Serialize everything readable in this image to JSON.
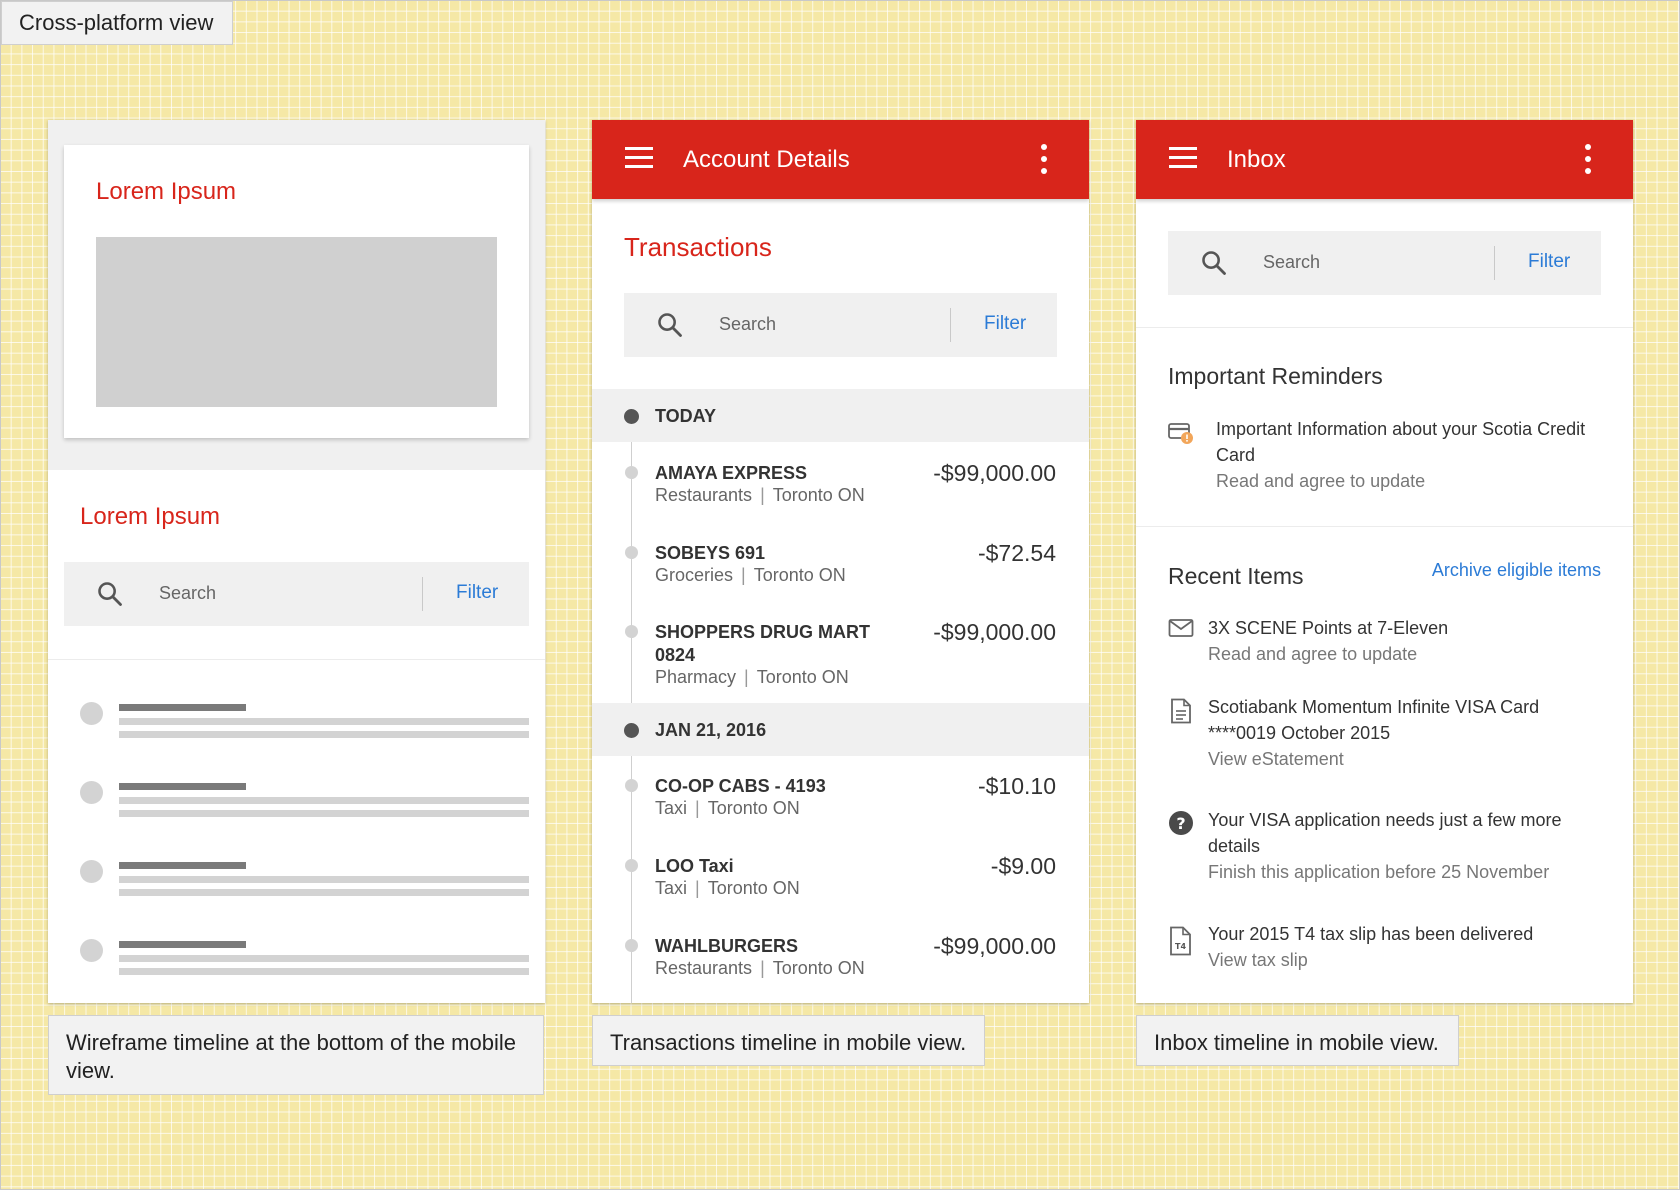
{
  "page": {
    "title": "Cross-platform view"
  },
  "captions": [
    "Wireframe timeline at the bottom of the mobile view.",
    "Transactions timeline in mobile view.",
    "Inbox timeline in mobile view."
  ],
  "wireframe": {
    "card_title": "Lorem Ipsum",
    "section_title": "Lorem Ipsum",
    "search_placeholder": "Search",
    "filter_label": "Filter"
  },
  "account": {
    "appbar_title": "Account Details",
    "section_title": "Transactions",
    "search_placeholder": "Search",
    "filter_label": "Filter",
    "groups": [
      {
        "date": "TODAY",
        "items": [
          {
            "name": "AMAYA EXPRESS",
            "category": "Restaurants",
            "location": "Toronto ON",
            "amount": "-$99,000.00"
          },
          {
            "name": "SOBEYS 691",
            "category": "Groceries",
            "location": "Toronto ON",
            "amount": "-$72.54"
          },
          {
            "name": "SHOPPERS DRUG MART 0824",
            "category": "Pharmacy",
            "location": "Toronto ON",
            "amount": "-$99,000.00"
          }
        ]
      },
      {
        "date": "JAN 21, 2016",
        "items": [
          {
            "name": "CO-OP CABS - 4193",
            "category": "Taxi",
            "location": "Toronto ON",
            "amount": "-$10.10"
          },
          {
            "name": "LOO Taxi",
            "category": "Taxi",
            "location": "Toronto ON",
            "amount": "-$9.00"
          },
          {
            "name": "WAHLBURGERS",
            "category": "Restaurants",
            "location": "Toronto ON",
            "amount": "-$99,000.00"
          }
        ]
      }
    ]
  },
  "inbox": {
    "appbar_title": "Inbox",
    "search_placeholder": "Search",
    "filter_label": "Filter",
    "reminders_title": "Important Reminders",
    "reminder": {
      "icon": "credit-card-alert-icon",
      "title": "Important Information about your Scotia Credit Card",
      "subtitle": "Read and agree to update"
    },
    "recent_title": "Recent Items",
    "archive_link": "Archive eligible items",
    "items": [
      {
        "icon": "envelope-icon",
        "title": "3X SCENE Points at 7-Eleven",
        "subtitle": "Read and agree to update"
      },
      {
        "icon": "document-icon",
        "title": "Scotiabank Momentum Infinite VISA Card ****0019 October 2015",
        "subtitle": "View eStatement"
      },
      {
        "icon": "help-icon",
        "title": "Your VISA application needs just a few more details",
        "subtitle": "Finish this application before 25 November"
      },
      {
        "icon": "t4-doc-icon",
        "title": "Your 2015 T4 tax slip has been delivered",
        "subtitle": "View tax slip"
      }
    ]
  },
  "colors": {
    "brand_red": "#d8251b",
    "link_blue": "#2b7bd6",
    "background_yellow": "#f5e8a6"
  }
}
